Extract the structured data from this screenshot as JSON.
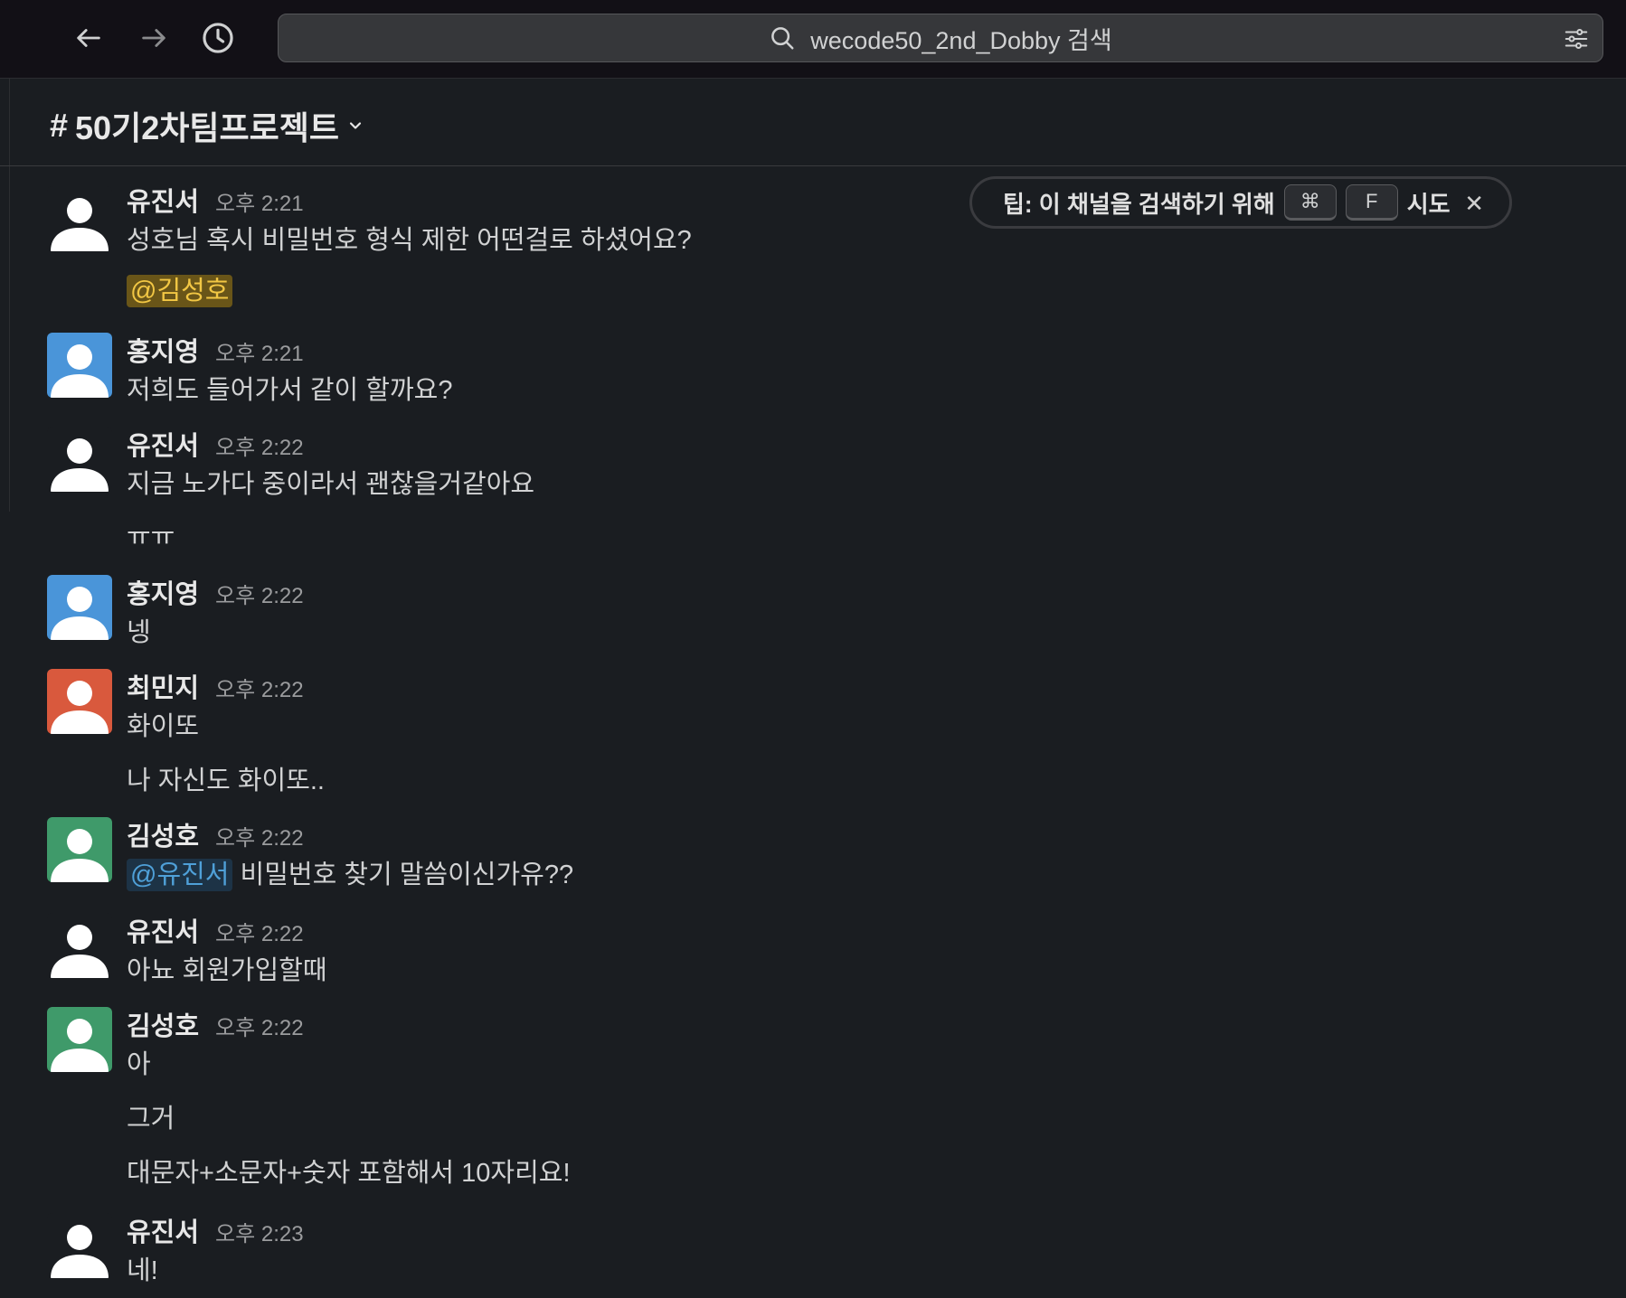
{
  "search": {
    "text": "wecode50_2nd_Dobby 검색"
  },
  "channel": {
    "prefix": "#",
    "name": "50기2차팀프로젝트"
  },
  "tip": {
    "text": "팁: 이 채널을 검색하기 위해",
    "key1": "⌘",
    "key2": "F",
    "suffix": "시도",
    "close": "✕"
  },
  "messages": [
    {
      "author": "유진서",
      "time": "오후 2:21",
      "line1": "성호님 혹시 비밀번호 형식 제한 어떤걸로 하셨어요?",
      "mention": "@김성호"
    },
    {
      "author": "홍지영",
      "time": "오후 2:21",
      "line1": "저희도 들어가서 같이 할까요?"
    },
    {
      "author": "유진서",
      "time": "오후 2:22",
      "line1": "지금 노가다 중이라서 괜찮을거같아요",
      "line2": "ㅠㅠ"
    },
    {
      "author": "홍지영",
      "time": "오후 2:22",
      "line1": "넹"
    },
    {
      "author": "최민지",
      "time": "오후 2:22",
      "line1": "화이또",
      "line2": "나 자신도 화이또.."
    },
    {
      "author": "김성호",
      "time": "오후 2:22",
      "mention": "@유진서",
      "line1": "비밀번호 찾기 말씀이신가유??"
    },
    {
      "author": "유진서",
      "time": "오후 2:22",
      "line1": "아뇨 회원가입할때"
    },
    {
      "author": "김성호",
      "time": "오후 2:22",
      "line1": "아",
      "line2": "그거",
      "line3": "대문자+소문자+숫자 포함해서 10자리요!"
    },
    {
      "author": "유진서",
      "time": "오후 2:23",
      "line1": "네!"
    }
  ],
  "colors": {
    "avatar_default": "#1a1d21",
    "avatar_blue": "#4a95d9",
    "avatar_orange": "#d9593d",
    "avatar_green": "#3f9a6a",
    "mention_yellow_bg": "#695518",
    "mention_blue_bg": "#1d3346"
  }
}
